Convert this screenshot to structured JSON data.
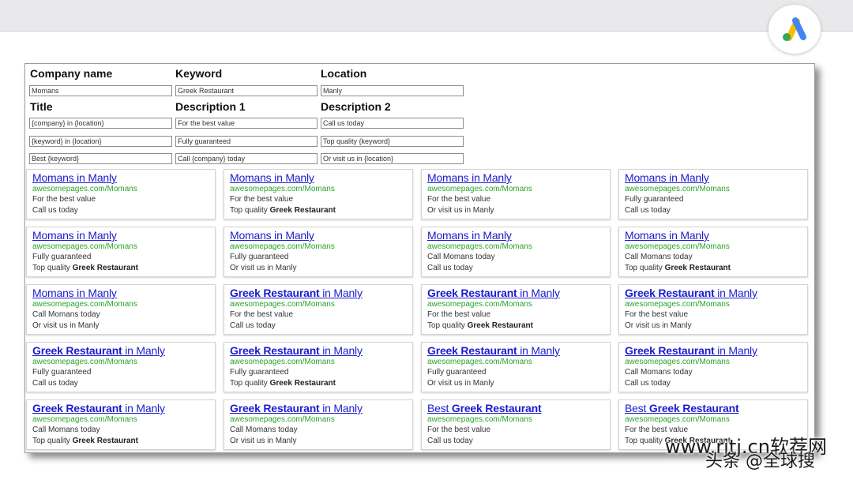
{
  "form": {
    "labels": {
      "company_name": "Company name",
      "keyword": "Keyword",
      "location": "Location",
      "title": "Title",
      "description1": "Description 1",
      "description2": "Description 2"
    },
    "values": {
      "company_name": "Momans",
      "keyword": "Greek Restaurant",
      "location": "Manly"
    },
    "rows": [
      {
        "title": "{company} in {location}",
        "desc1": "For the best value",
        "desc2": "Call us today"
      },
      {
        "title": "{keyword} in {location}",
        "desc1": "Fully guaranteed",
        "desc2": "Top quality {keyword}"
      },
      {
        "title": "Best {keyword}",
        "desc1": "Call {company} today",
        "desc2": "Or visit us in {location}"
      }
    ]
  },
  "ads": [
    {
      "title_pre": "",
      "title_bold": "",
      "title_post": "Momans in Manly",
      "url": "awesomepages.com/Momans",
      "line1_pre": "For the best value",
      "line1_bold": "",
      "line2_pre": "Call us today",
      "line2_bold": ""
    },
    {
      "title_pre": "",
      "title_bold": "",
      "title_post": "Momans in Manly",
      "url": "awesomepages.com/Momans",
      "line1_pre": "For the best value",
      "line1_bold": "",
      "line2_pre": "Top quality ",
      "line2_bold": "Greek Restaurant"
    },
    {
      "title_pre": "",
      "title_bold": "",
      "title_post": "Momans in Manly",
      "url": "awesomepages.com/Momans",
      "line1_pre": "For the best value",
      "line1_bold": "",
      "line2_pre": "Or visit us in Manly",
      "line2_bold": ""
    },
    {
      "title_pre": "",
      "title_bold": "",
      "title_post": "Momans in Manly",
      "url": "awesomepages.com/Momans",
      "line1_pre": "Fully guaranteed",
      "line1_bold": "",
      "line2_pre": "Call us today",
      "line2_bold": ""
    },
    {
      "title_pre": "",
      "title_bold": "",
      "title_post": "Momans in Manly",
      "url": "awesomepages.com/Momans",
      "line1_pre": "Fully guaranteed",
      "line1_bold": "",
      "line2_pre": "Top quality ",
      "line2_bold": "Greek Restaurant"
    },
    {
      "title_pre": "",
      "title_bold": "",
      "title_post": "Momans in Manly",
      "url": "awesomepages.com/Momans",
      "line1_pre": "Fully guaranteed",
      "line1_bold": "",
      "line2_pre": "Or visit us in Manly",
      "line2_bold": ""
    },
    {
      "title_pre": "",
      "title_bold": "",
      "title_post": "Momans in Manly",
      "url": "awesomepages.com/Momans",
      "line1_pre": "Call Momans today",
      "line1_bold": "",
      "line2_pre": "Call us today",
      "line2_bold": ""
    },
    {
      "title_pre": "",
      "title_bold": "",
      "title_post": "Momans in Manly",
      "url": "awesomepages.com/Momans",
      "line1_pre": "Call Momans today",
      "line1_bold": "",
      "line2_pre": "Top quality ",
      "line2_bold": "Greek Restaurant"
    },
    {
      "title_pre": "",
      "title_bold": "",
      "title_post": "Momans in Manly",
      "url": "awesomepages.com/Momans",
      "line1_pre": "Call Momans today",
      "line1_bold": "",
      "line2_pre": "Or visit us in Manly",
      "line2_bold": ""
    },
    {
      "title_pre": "",
      "title_bold": "Greek Restaurant",
      "title_post": " in Manly",
      "url": "awesomepages.com/Momans",
      "line1_pre": "For the best value",
      "line1_bold": "",
      "line2_pre": "Call us today",
      "line2_bold": ""
    },
    {
      "title_pre": "",
      "title_bold": "Greek Restaurant",
      "title_post": " in Manly",
      "url": "awesomepages.com/Momans",
      "line1_pre": "For the best value",
      "line1_bold": "",
      "line2_pre": "Top quality ",
      "line2_bold": "Greek Restaurant"
    },
    {
      "title_pre": "",
      "title_bold": "Greek Restaurant",
      "title_post": " in Manly",
      "url": "awesomepages.com/Momans",
      "line1_pre": "For the best value",
      "line1_bold": "",
      "line2_pre": "Or visit us in Manly",
      "line2_bold": ""
    },
    {
      "title_pre": "",
      "title_bold": "Greek Restaurant",
      "title_post": " in Manly",
      "url": "awesomepages.com/Momans",
      "line1_pre": "Fully guaranteed",
      "line1_bold": "",
      "line2_pre": "Call us today",
      "line2_bold": ""
    },
    {
      "title_pre": "",
      "title_bold": "Greek Restaurant",
      "title_post": " in Manly",
      "url": "awesomepages.com/Momans",
      "line1_pre": "Fully guaranteed",
      "line1_bold": "",
      "line2_pre": "Top quality ",
      "line2_bold": "Greek Restaurant"
    },
    {
      "title_pre": "",
      "title_bold": "Greek Restaurant",
      "title_post": " in Manly",
      "url": "awesomepages.com/Momans",
      "line1_pre": "Fully guaranteed",
      "line1_bold": "",
      "line2_pre": "Or visit us in Manly",
      "line2_bold": ""
    },
    {
      "title_pre": "",
      "title_bold": "Greek Restaurant",
      "title_post": " in Manly",
      "url": "awesomepages.com/Momans",
      "line1_pre": "Call Momans today",
      "line1_bold": "",
      "line2_pre": "Call us today",
      "line2_bold": ""
    },
    {
      "title_pre": "",
      "title_bold": "Greek Restaurant",
      "title_post": " in Manly",
      "url": "awesomepages.com/Momans",
      "line1_pre": "Call Momans today",
      "line1_bold": "",
      "line2_pre": "Top quality ",
      "line2_bold": "Greek Restaurant"
    },
    {
      "title_pre": "",
      "title_bold": "Greek Restaurant",
      "title_post": " in Manly",
      "url": "awesomepages.com/Momans",
      "line1_pre": "Call Momans today",
      "line1_bold": "",
      "line2_pre": "Or visit us in Manly",
      "line2_bold": ""
    },
    {
      "title_pre": "Best ",
      "title_bold": "Greek Restaurant",
      "title_post": "",
      "url": "awesomepages.com/Momans",
      "line1_pre": "For the best value",
      "line1_bold": "",
      "line2_pre": "Call us today",
      "line2_bold": ""
    },
    {
      "title_pre": "Best ",
      "title_bold": "Greek Restaurant",
      "title_post": "",
      "url": "awesomepages.com/Momans",
      "line1_pre": "For the best value",
      "line1_bold": "",
      "line2_pre": "Top quality ",
      "line2_bold": "Greek Restaurant"
    }
  ],
  "watermark": {
    "line1": "www.rjtj.cn软荐网",
    "line2": "头条 @全球搜"
  },
  "colors": {
    "ad_title": "#1c1ccf",
    "ad_url": "#2aa32a",
    "logo_blue": "#4285f4",
    "logo_green": "#34a853",
    "logo_yellow": "#fbbc04"
  },
  "icons": {
    "logo": "google-ads-logo-icon"
  }
}
